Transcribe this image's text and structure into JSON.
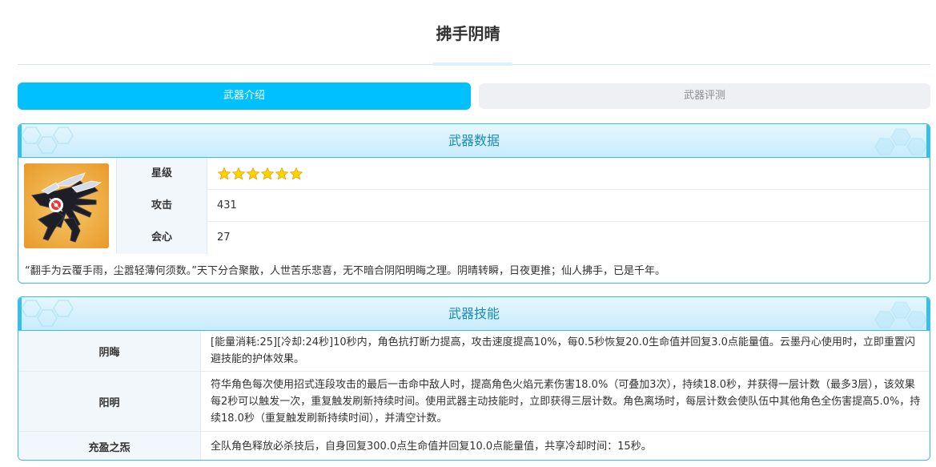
{
  "page": {
    "title": "拂手阴晴"
  },
  "tabs": [
    {
      "label": "武器介绍",
      "active": true
    },
    {
      "label": "武器评测",
      "active": false
    }
  ],
  "weapon_data": {
    "heading": "武器数据",
    "stats": {
      "rarity_label": "星级",
      "rarity_stars": 6,
      "attack_label": "攻击",
      "attack_value": "431",
      "crit_label": "会心",
      "crit_value": "27"
    },
    "quote": "“翻手为云覆手雨，尘嚣轻薄何须数。”天下分合聚散，人世苦乐悲喜，无不暗合阴阳明晦之理。阴晴转瞬，日夜更推；仙人拂手，已是千年。"
  },
  "weapon_skills": {
    "heading": "武器技能",
    "skills": [
      {
        "name": "阴晦",
        "description": "[能量消耗:25][冷却:24秒]10秒内，角色抗打断力提高，攻击速度提高10%，每0.5秒恢复20.0生命值并回复3.0点能量值。云墨丹心使用时，立即重置闪避技能的护体效果。"
      },
      {
        "name": "阳明",
        "description": "符华角色每次使用招式连段攻击的最后一击命中敌人时，提高角色火焰元素伤害18.0%（可叠加3次），持续18.0秒，并获得一层计数（最多3层），该效果每2秒可以触发一次，重复触发刷新持续时间。使用武器主动技能时，立即获得三层计数。角色离场时，每层计数会使队伍中其他角色全伤害提高5.0%，持续18.0秒（重复触发刷新持续时间），并清空计数。"
      },
      {
        "name": "充盈之炁",
        "description": "全队角色释放必杀技后，自身回复300.0点生命值并回复10.0点能量值，共享冷却时间：15秒。"
      }
    ]
  },
  "colors": {
    "accent": "#00c0ff",
    "panel_border": "#35c0ec",
    "header_text": "#1a8ab8",
    "star": "#ffd200"
  },
  "icons": {
    "star": "star-icon",
    "weapon": "weapon-gauntlet-image"
  }
}
